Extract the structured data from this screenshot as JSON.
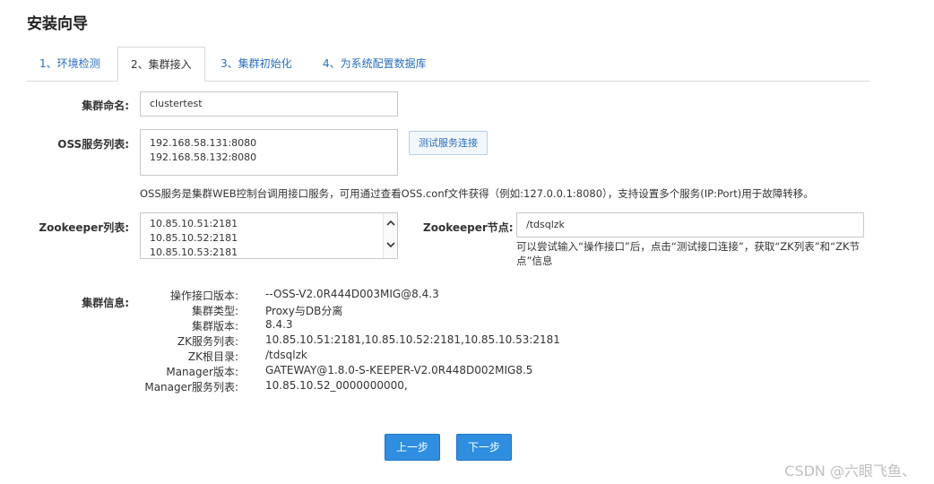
{
  "page": {
    "title": "安装向导"
  },
  "tabs": [
    {
      "label": "1、环境检测"
    },
    {
      "label": "2、集群接入"
    },
    {
      "label": "3、集群初始化"
    },
    {
      "label": "4、为系统配置数据库"
    }
  ],
  "form": {
    "cluster_name_label": "集群命名:",
    "cluster_name_value": "clustertest",
    "oss_label": "OSS服务列表:",
    "oss_lines": [
      "192.168.58.131:8080",
      "192.168.58.132:8080"
    ],
    "test_button": "测试服务连接",
    "oss_hint": "OSS服务是集群WEB控制台调用接口服务，可用通过查看OSS.conf文件获得（例如:127.0.0.1:8080），支持设置多个服务(IP:Port)用于故障转移。",
    "zk_label": "Zookeeper列表:",
    "zk_lines": [
      "10.85.10.51:2181",
      "10.85.10.52:2181",
      "10.85.10.53:2181"
    ],
    "zk_node_label": "Zookeeper节点:",
    "zk_node_value": "/tdsqlzk",
    "zk_node_hint_1": "可以尝试输入“操作接口”后，点击“测试接口连接”，获取“ZK列表”和“ZK节",
    "zk_node_hint_2": "点”信息"
  },
  "cluster_info": {
    "label": "集群信息:",
    "rows": [
      {
        "key": "操作接口版本:",
        "value": "--OSS-V2.0R444D003MIG@8.4.3"
      },
      {
        "key": "集群类型:",
        "value": "Proxy与DB分离"
      },
      {
        "key": "集群版本:",
        "value": "8.4.3"
      },
      {
        "key": "ZK服务列表:",
        "value": "10.85.10.51:2181,10.85.10.52:2181,10.85.10.53:2181"
      },
      {
        "key": "ZK根目录:",
        "value": "/tdsqlzk"
      },
      {
        "key": "Manager版本:",
        "value": "GATEWAY@1.8.0-S-KEEPER-V2.0R448D002MIG8.5"
      },
      {
        "key": "Manager服务列表:",
        "value": "10.85.10.52_0000000000,"
      }
    ]
  },
  "buttons": {
    "prev": "上一步",
    "next": "下一步"
  },
  "watermark": "CSDN @六眼飞鱼、",
  "colors": {
    "primary": "#2f8ee0",
    "link": "#2a6ebb",
    "border": "#d9d9d9"
  }
}
